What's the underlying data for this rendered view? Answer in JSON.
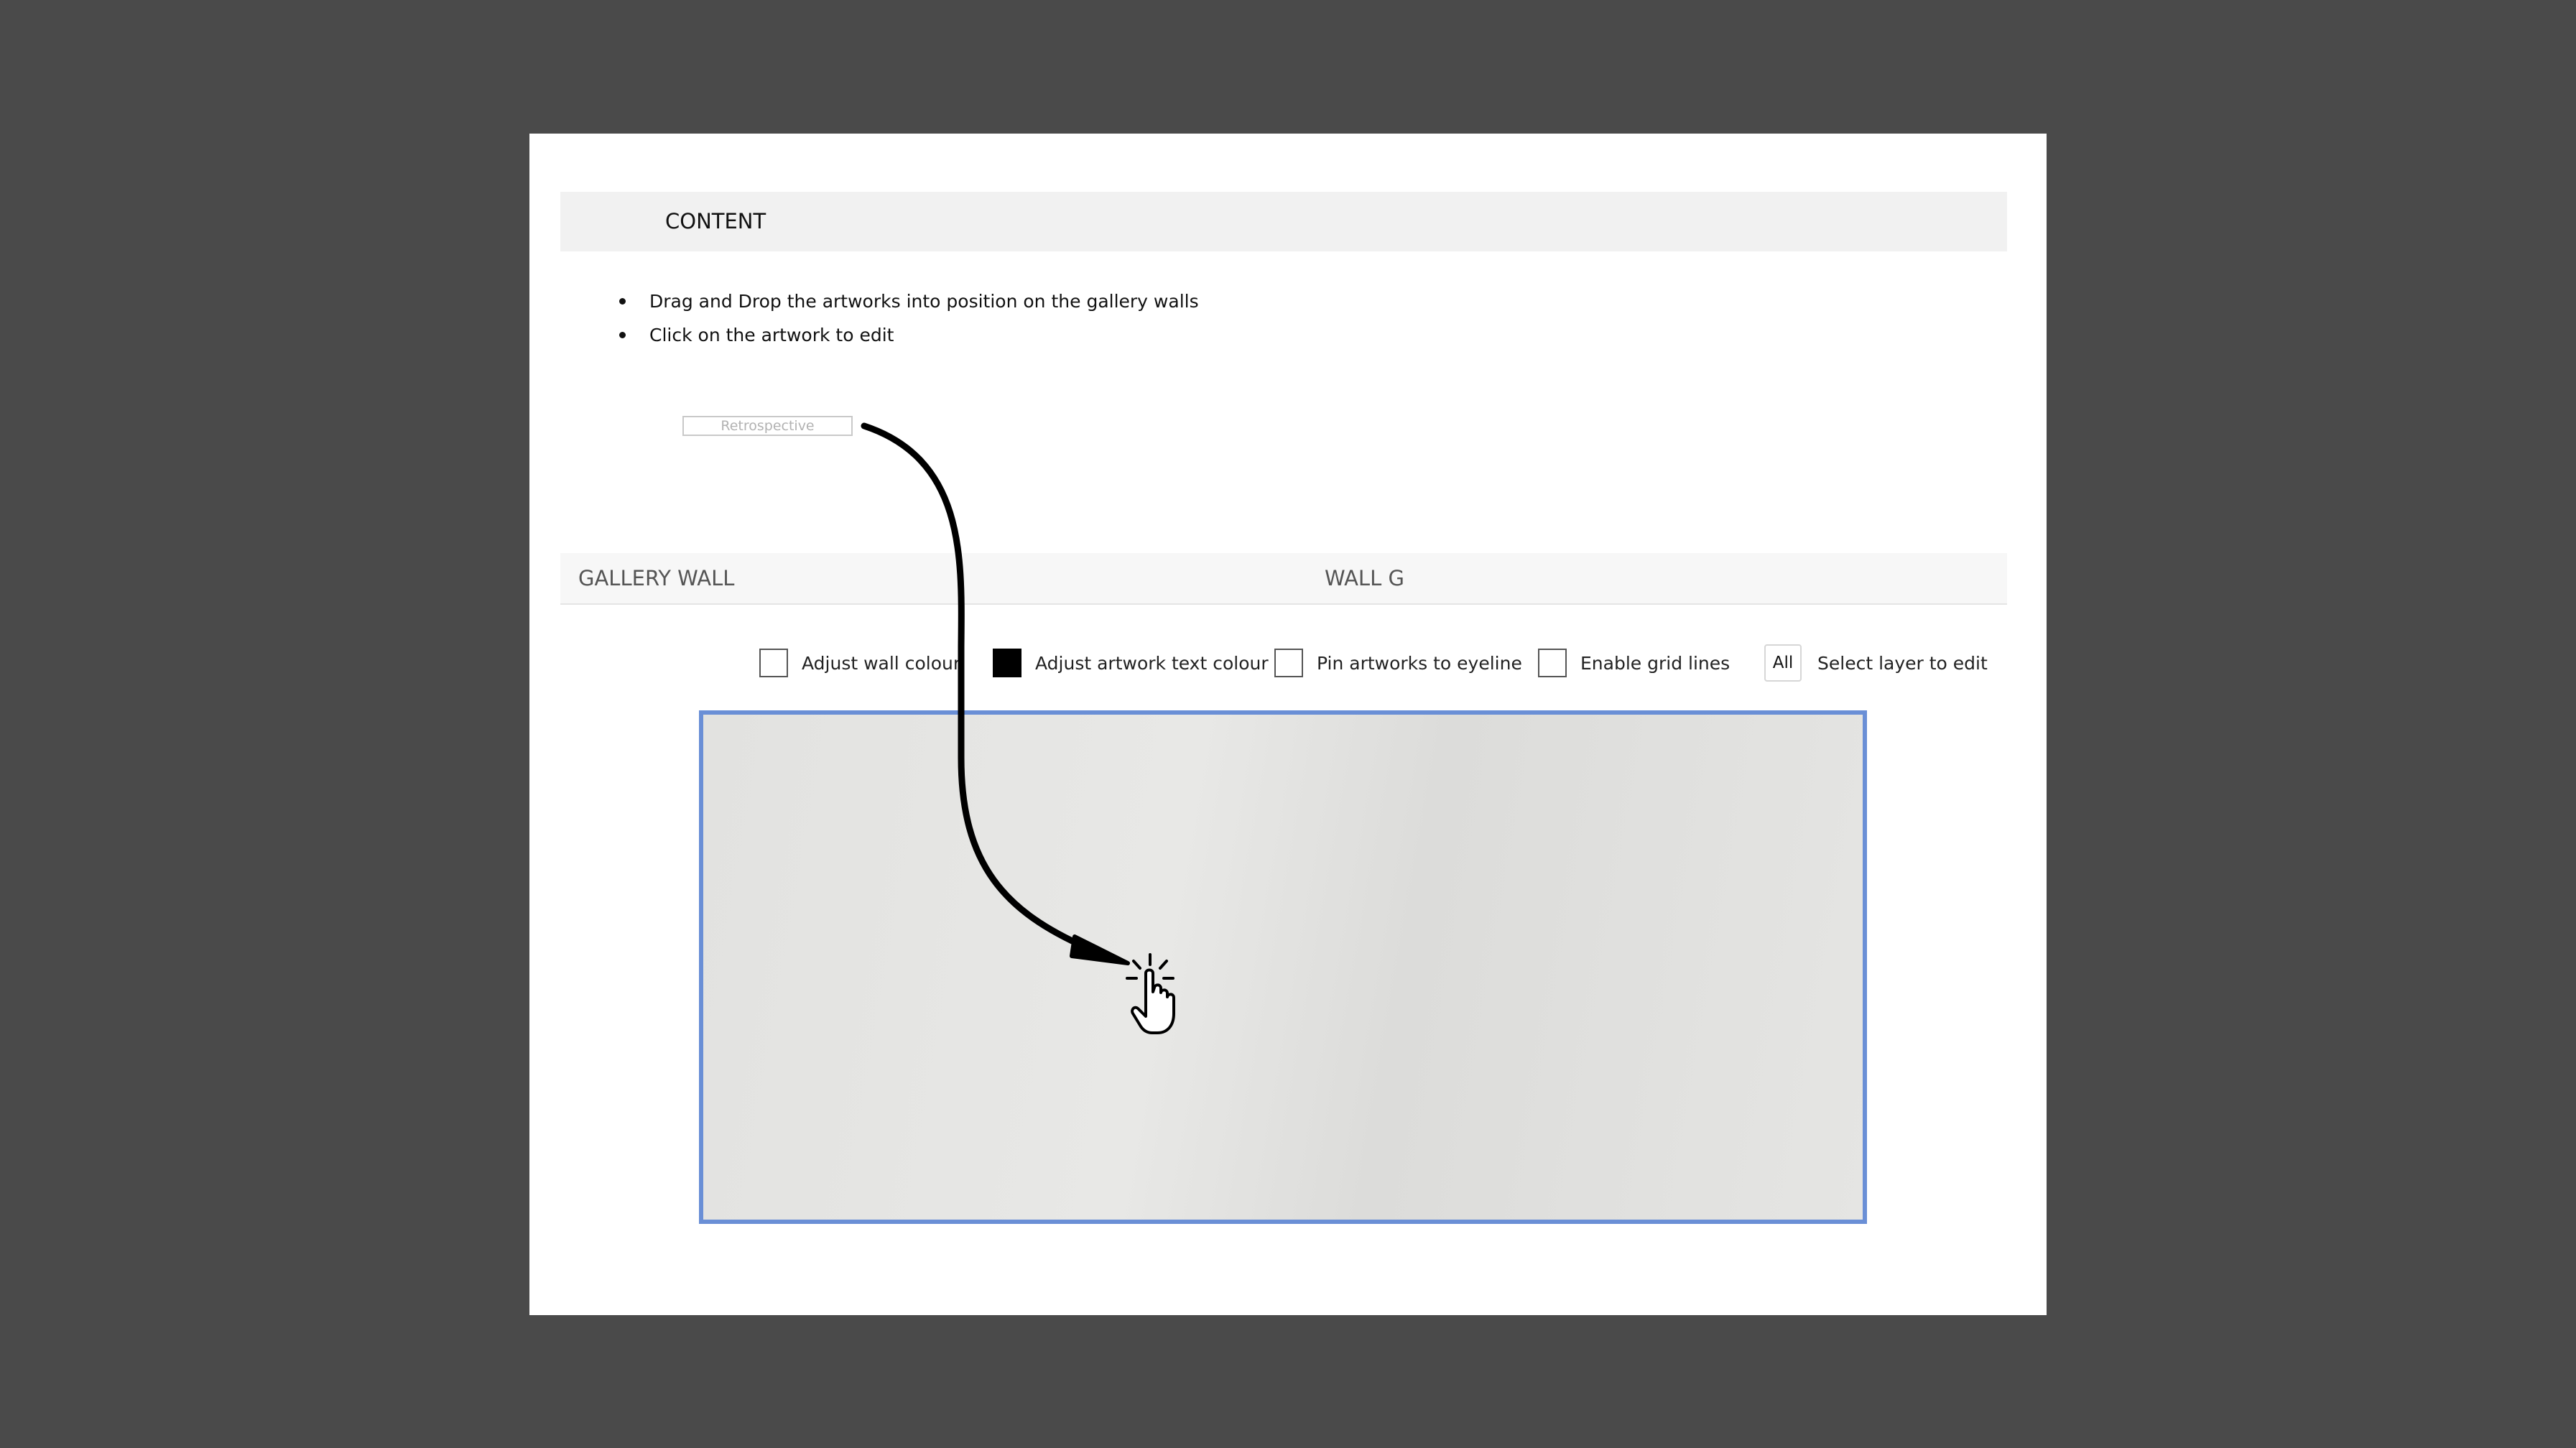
{
  "content": {
    "title": "CONTENT",
    "instructions": [
      "Drag and Drop the artworks into position on the gallery walls",
      "Click on the artwork to edit"
    ],
    "artwork_label": "Retrospective"
  },
  "gallery": {
    "title": "GALLERY WALL",
    "wall_name": "WALL G"
  },
  "toolbar": {
    "wall_colour_label": "Adjust wall colour",
    "wall_colour_checked": false,
    "text_colour_label": "Adjust artwork text colour",
    "text_colour_swatch": "#000000",
    "eyeline_label": "Pin artworks to eyeline",
    "eyeline_checked": false,
    "grid_label": "Enable grid lines",
    "grid_checked": false,
    "layer_value": "All",
    "layer_label": "Select layer to edit"
  },
  "colors": {
    "backdrop": "#4a4a4a",
    "panel": "#ffffff",
    "canvas_border": "#6a8fd6",
    "wall": "#e2e2e0"
  },
  "icons": {
    "drag_arrow": "curved-arrow-icon",
    "pointer": "hand-pointer-icon"
  }
}
